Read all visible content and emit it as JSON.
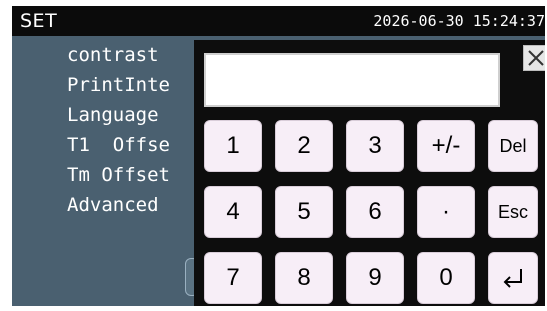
{
  "header": {
    "title": "SET",
    "datetime": "2026-06-30 15:24:37"
  },
  "menu": {
    "items": [
      {
        "label": "contrast"
      },
      {
        "label": "PrintInte"
      },
      {
        "label": "Language"
      },
      {
        "label": "T1  Offse"
      },
      {
        "label": "Tm Offset"
      },
      {
        "label": "Advanced"
      }
    ]
  },
  "keypad": {
    "display_value": "",
    "keys": {
      "k1": "1",
      "k2": "2",
      "k3": "3",
      "sign": "+/-",
      "del": "Del",
      "k4": "4",
      "k5": "5",
      "k6": "6",
      "dot": "·",
      "esc": "Esc",
      "k7": "7",
      "k8": "8",
      "k9": "9",
      "k0": "0"
    },
    "icons": {
      "close": "close-icon",
      "enter": "enter-icon"
    }
  },
  "colors": {
    "topbar": "#0b0b0b",
    "background": "#4a6070",
    "keypad": "#0d0d0d",
    "key": "#f7eef7"
  }
}
